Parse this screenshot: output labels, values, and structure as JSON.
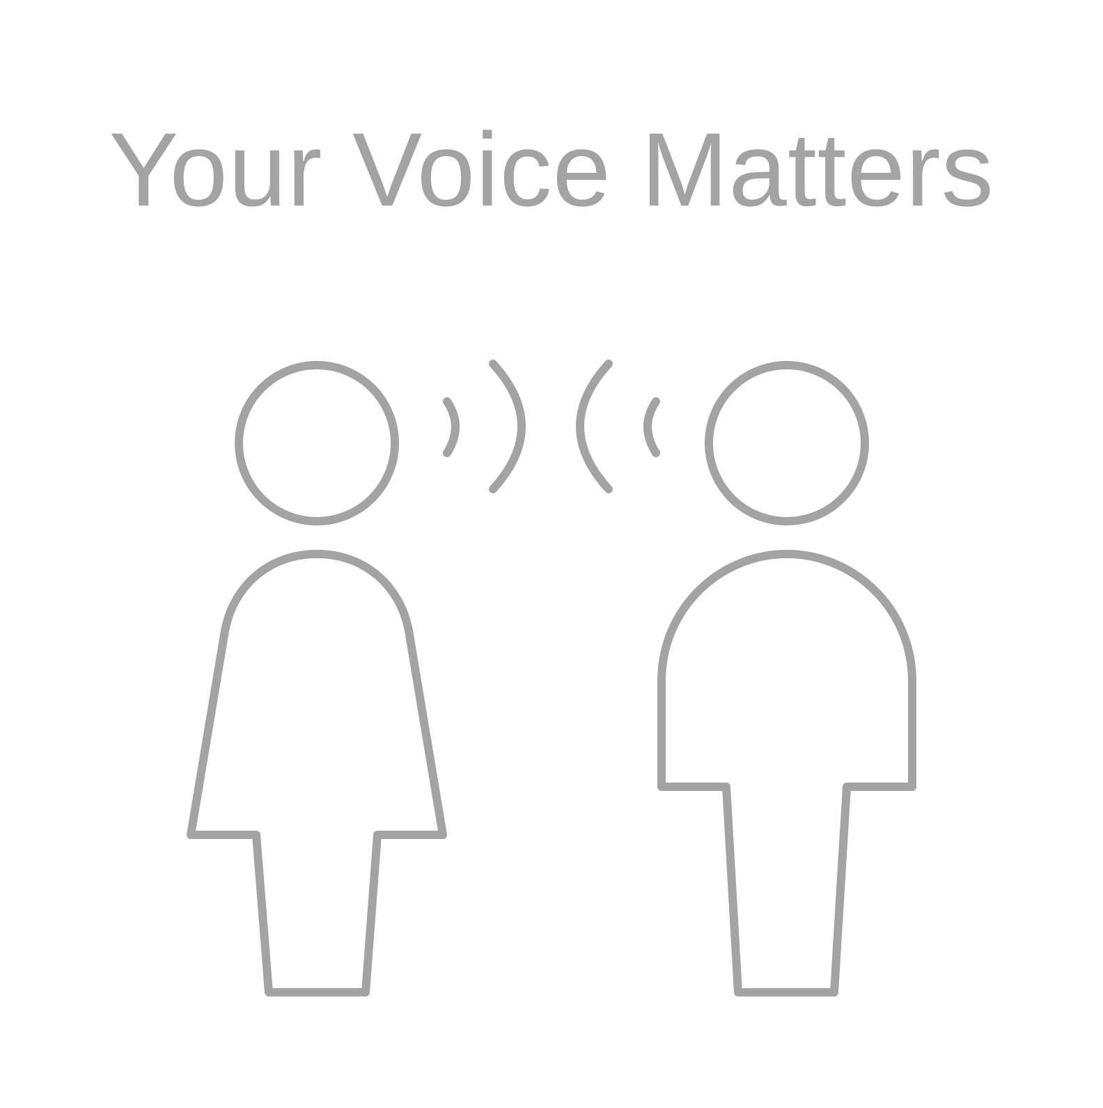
{
  "title": "Your Voice Matters",
  "colors": {
    "ink": "#a3a3a3",
    "background": "#ffffff"
  },
  "illustration": {
    "figures": [
      "person-left-icon",
      "person-right-icon"
    ],
    "sound_waves": [
      "sound-waves-left-icon",
      "sound-waves-right-icon"
    ]
  }
}
